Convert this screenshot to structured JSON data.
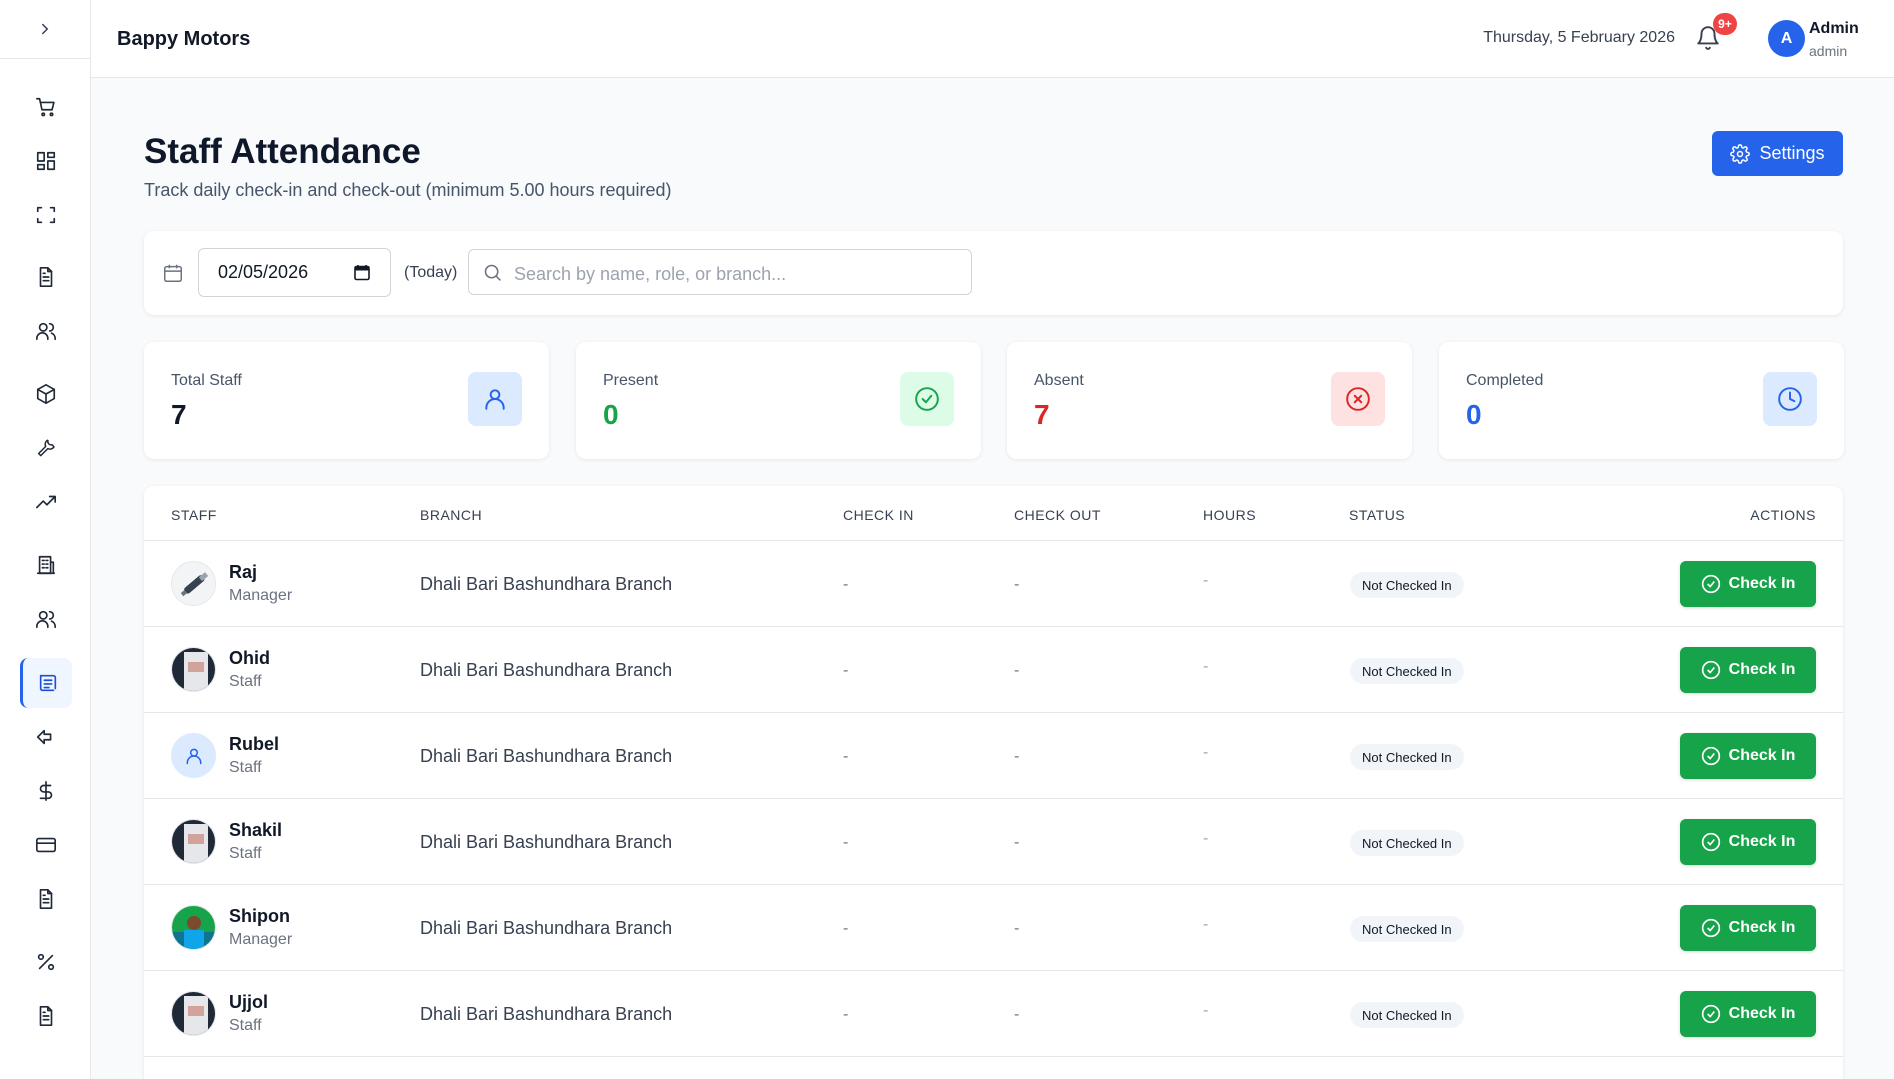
{
  "app": {
    "brand": "Bappy Motors"
  },
  "header": {
    "date": "Thursday, 5 February 2026",
    "notifications_badge": "9+",
    "user": {
      "initial": "A",
      "name": "Admin",
      "role": "admin"
    }
  },
  "sidebar": {
    "items": [
      {
        "icon": "cart-icon"
      },
      {
        "icon": "grid-icon"
      },
      {
        "icon": "scan-icon"
      },
      {
        "icon": "document-icon"
      },
      {
        "icon": "users-icon"
      },
      {
        "icon": "box-icon"
      },
      {
        "icon": "wrench-icon"
      },
      {
        "icon": "trending-up-icon"
      },
      {
        "icon": "building-icon"
      },
      {
        "icon": "users-icon"
      },
      {
        "icon": "attendance-icon",
        "active": true
      },
      {
        "icon": "return-icon"
      },
      {
        "icon": "dollar-icon"
      },
      {
        "icon": "credit-card-icon"
      },
      {
        "icon": "document-icon"
      },
      {
        "icon": "percent-icon"
      },
      {
        "icon": "document-icon"
      }
    ]
  },
  "page": {
    "title": "Staff Attendance",
    "subtitle": "Track daily check-in and check-out (minimum 5.00 hours required)",
    "settings_label": "Settings"
  },
  "filters": {
    "date_value": "02/05/2026",
    "today_label": "(Today)",
    "search_placeholder": "Search by name, role, or branch..."
  },
  "stats": [
    {
      "label": "Total Staff",
      "value": "7",
      "color": "#111827",
      "icon": "user-icon"
    },
    {
      "label": "Present",
      "value": "0",
      "color": "#16a34a",
      "icon": "check-circle-icon"
    },
    {
      "label": "Absent",
      "value": "7",
      "color": "#dc2626",
      "icon": "x-circle-icon"
    },
    {
      "label": "Completed",
      "value": "0",
      "color": "#2563eb",
      "icon": "clock-icon"
    }
  ],
  "table": {
    "headers": {
      "staff": "STAFF",
      "branch": "BRANCH",
      "check_in": "CHECK IN",
      "check_out": "CHECK OUT",
      "hours": "HOURS",
      "status": "STATUS",
      "actions": "ACTIONS"
    },
    "rows": [
      {
        "name": "Raj",
        "role": "Manager",
        "branch": "Dhali Bari Bashundhara Branch",
        "check_in": "-",
        "check_out": "-",
        "hours": "-",
        "status": "Not Checked In",
        "action": "Check In"
      },
      {
        "name": "Ohid",
        "role": "Staff",
        "branch": "Dhali Bari Bashundhara Branch",
        "check_in": "-",
        "check_out": "-",
        "hours": "-",
        "status": "Not Checked In",
        "action": "Check In"
      },
      {
        "name": "Rubel",
        "role": "Staff",
        "branch": "Dhali Bari Bashundhara Branch",
        "check_in": "-",
        "check_out": "-",
        "hours": "-",
        "status": "Not Checked In",
        "action": "Check In"
      },
      {
        "name": "Shakil",
        "role": "Staff",
        "branch": "Dhali Bari Bashundhara Branch",
        "check_in": "-",
        "check_out": "-",
        "hours": "-",
        "status": "Not Checked In",
        "action": "Check In"
      },
      {
        "name": "Shipon",
        "role": "Manager",
        "branch": "Dhali Bari Bashundhara Branch",
        "check_in": "-",
        "check_out": "-",
        "hours": "-",
        "status": "Not Checked In",
        "action": "Check In"
      },
      {
        "name": "Ujjol",
        "role": "Staff",
        "branch": "Dhali Bari Bashundhara Branch",
        "check_in": "-",
        "check_out": "-",
        "hours": "-",
        "status": "Not Checked In",
        "action": "Check In"
      }
    ]
  },
  "colors": {
    "accent": "#2563eb",
    "success": "#16a34a",
    "danger": "#dc2626"
  }
}
